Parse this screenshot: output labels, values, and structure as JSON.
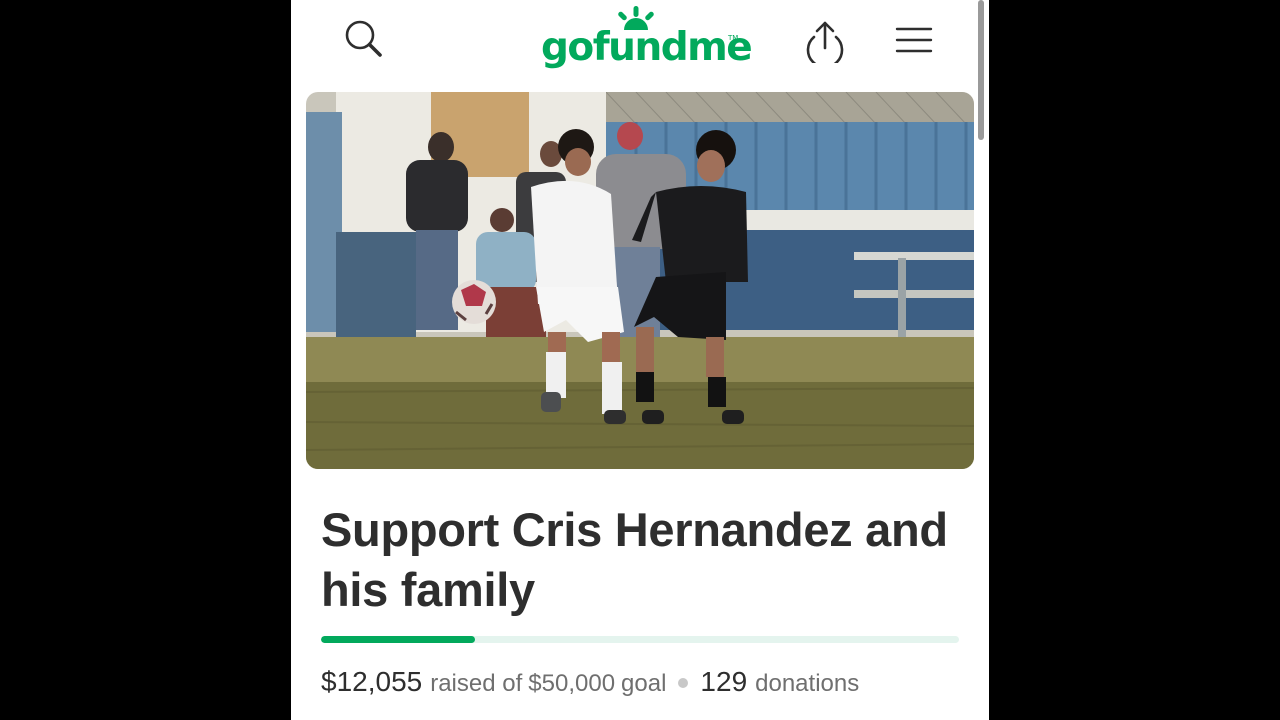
{
  "app": {
    "logo_text": "gofundme",
    "logo_tm": "TM"
  },
  "header": {
    "icons": [
      "search-icon",
      "share-icon",
      "menu-icon"
    ]
  },
  "campaign": {
    "title": "Support Cris Hernandez and his family",
    "amount_raised": "$12,055",
    "raised_text": "raised of",
    "goal_amount": "$50,000",
    "goal_word": "goal",
    "donations_count": "129",
    "donations_label": "donations",
    "progress_fraction": 0.2411
  },
  "colors": {
    "brand": "#02a95c",
    "progress_track": "#e4f4ee",
    "text_dark": "#2e2e2e",
    "text_muted": "#6f6f6f"
  }
}
